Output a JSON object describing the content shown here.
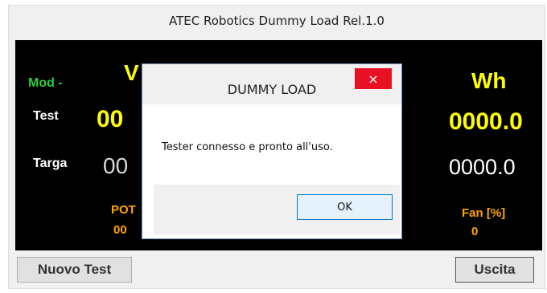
{
  "window": {
    "title": "ATEC Robotics Dummy  Load Rel.1.0"
  },
  "panel": {
    "mod_label": "Mod -",
    "test_label": "Test",
    "targa_label": "Targa",
    "v_head": "V",
    "test_left_value": "00",
    "targa_left_value": "00",
    "wh_head": "Wh",
    "wh_test": "0000.0",
    "wh_targa": "0000.0",
    "pot_head": "POT",
    "pot_value": "00",
    "fan_head": "Fan [%]",
    "fan_value": "0"
  },
  "buttons": {
    "nuovo_test": "Nuovo Test",
    "uscita": "Uscita"
  },
  "dialog": {
    "title": "DUMMY LOAD",
    "close_glyph": "×",
    "message": "Tester connesso e pronto all'uso.",
    "ok_label": "OK"
  }
}
